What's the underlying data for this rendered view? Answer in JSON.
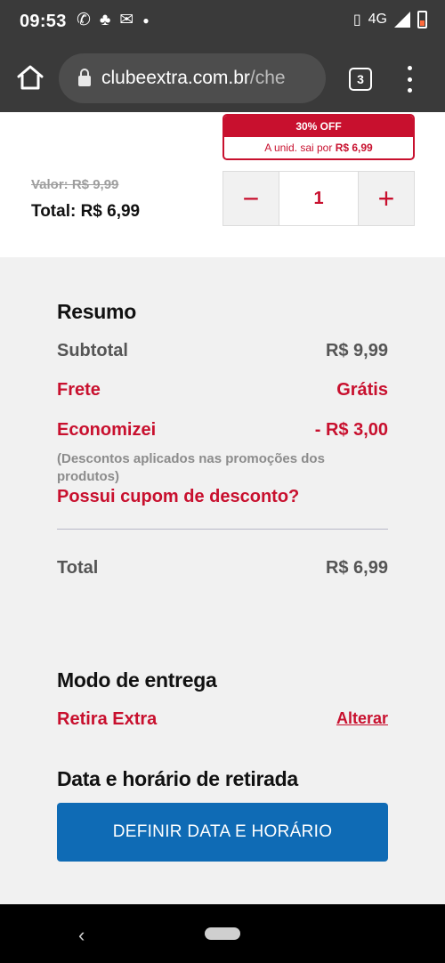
{
  "status_bar": {
    "time": "09:53",
    "network": "4G",
    "icons": [
      "whatsapp-icon",
      "notification-icon",
      "gmail-icon",
      "dot-icon",
      "vibrate-icon",
      "signal-icon",
      "battery-icon"
    ]
  },
  "browser": {
    "url_domain": "clubeextra.com.br",
    "url_rest": "/che",
    "tab_count": "3"
  },
  "product": {
    "promo_title": "30% OFF",
    "promo_prefix": "A unid. sai por",
    "promo_price": "R$ 6,99",
    "old_price": "Valor: R$ 9,99",
    "total_price": "Total: R$ 6,99",
    "quantity": "1",
    "minus_label": "−",
    "plus_label": "+"
  },
  "summary": {
    "title": "Resumo",
    "subtotal_label": "Subtotal",
    "subtotal_value": "R$ 9,99",
    "shipping_label": "Frete",
    "shipping_value": "Grátis",
    "saved_label": "Economizei",
    "saved_value": "- R$ 3,00",
    "discount_note": "(Descontos aplicados nas promoções dos produtos)",
    "coupon_link": "Possui cupom de desconto?",
    "total_label": "Total",
    "total_value": "R$ 6,99"
  },
  "delivery": {
    "title": "Modo de entrega",
    "mode": "Retira Extra",
    "change_link": "Alterar"
  },
  "pickup": {
    "title": "Data e horário de retirada",
    "button_label": "DEFINIR DATA E HORÁRIO"
  },
  "colors": {
    "accent_red": "#c8102e",
    "button_blue": "#0f6bb5",
    "chrome_gray": "#3a3a3a",
    "summary_bg": "#f1f1f1"
  }
}
